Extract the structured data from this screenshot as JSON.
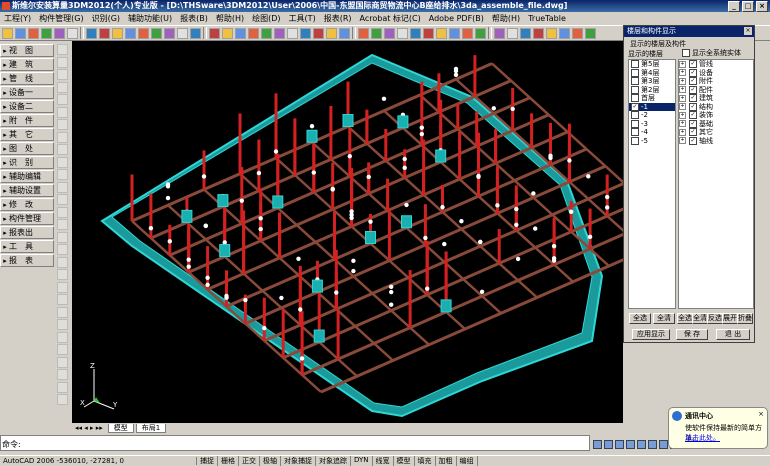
{
  "window": {
    "title": "斯维尔安装算量3DM2012(个人)专业版 - [D:\\THSware\\3DM2012\\User\\2006\\中国-东盟国际商贸物流中心B座给排水\\3da_assemble_file.dwg]"
  },
  "menu": [
    "工程(Y)",
    "构件管理(G)",
    "识别(G)",
    "辅助功能(U)",
    "报表(B)",
    "帮助(H)",
    "绘图(D)",
    "工具(T)",
    "报表(R)",
    "Acrobat 标记(C)",
    "Adobe PDF(B)",
    "帮助(H)",
    "TrueTable"
  ],
  "left_menu": [
    "视　图",
    "建　筑",
    "管　线",
    "设备一",
    "设备二",
    "附　件",
    "其　它",
    "图　处",
    "识　别",
    "辅助编辑",
    "辅助设置",
    "修　改",
    "构件管理",
    "报表出",
    "工　具",
    "报　表"
  ],
  "layout_tabs": [
    "模型",
    "布局1"
  ],
  "panel": {
    "title": "楼层和构件显示",
    "group_label": "显示的楼层及构件",
    "floors_label": "显示的楼层",
    "show_all_label": "显示全系统实体",
    "floors": [
      {
        "name": "第5层",
        "checked": false
      },
      {
        "name": "第4层",
        "checked": false
      },
      {
        "name": "第3层",
        "checked": false
      },
      {
        "name": "第2层",
        "checked": false
      },
      {
        "name": "首层",
        "checked": false
      },
      {
        "name": "-1",
        "checked": true,
        "selected": true
      },
      {
        "name": "-2",
        "checked": false
      },
      {
        "name": "-3",
        "checked": false
      },
      {
        "name": "-4",
        "checked": false
      },
      {
        "name": "-5",
        "checked": false
      }
    ],
    "components": [
      {
        "name": "管线",
        "checked": true
      },
      {
        "name": "设备",
        "checked": true
      },
      {
        "name": "附件",
        "checked": true
      },
      {
        "name": "配件",
        "checked": true
      },
      {
        "name": "建筑",
        "checked": true
      },
      {
        "name": "结构",
        "checked": true
      },
      {
        "name": "装饰",
        "checked": true
      },
      {
        "name": "基础",
        "checked": true
      },
      {
        "name": "其它",
        "checked": true
      },
      {
        "name": "轴线",
        "checked": true
      }
    ],
    "buttons_left": [
      "全选",
      "全清"
    ],
    "buttons_right": [
      "全选",
      "全清",
      "反选",
      "展开",
      "折叠"
    ],
    "apply_label": "应用显示",
    "save_label": "保 存",
    "exit_label": "退 出"
  },
  "command": {
    "prompt": "命令:"
  },
  "status": {
    "coords": "AutoCAD 2006 -536010, -27281, 0",
    "toggles": [
      "捕捉",
      "栅格",
      "正交",
      "极轴",
      "对象捕捉",
      "对象追踪",
      "DYN",
      "线宽",
      "模型"
    ],
    "extra": [
      "填充",
      "加粗",
      "编组"
    ]
  },
  "balloon": {
    "title": "通讯中心",
    "text": "使软件保持最新的简单方法。",
    "link": "单击此处。"
  },
  "colors": {
    "pipe_red": "#d42020",
    "beam_brown": "#8a4a3a",
    "slab_cyan": "#2fd6d6",
    "canvas_bg": "#000000"
  }
}
